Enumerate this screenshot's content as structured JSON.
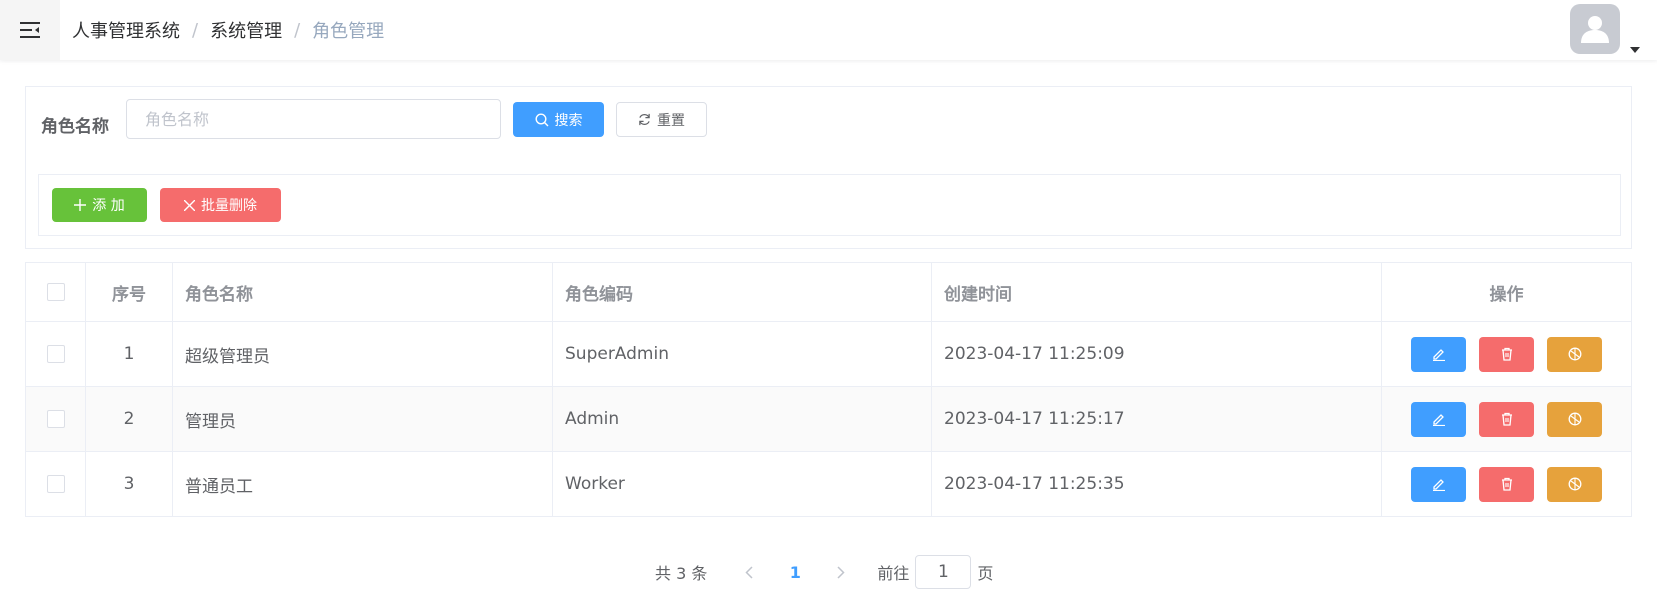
{
  "header": {
    "menu_toggle_icon": "fold-menu-icon",
    "breadcrumb": [
      "人事管理系统",
      "系统管理",
      "角色管理"
    ],
    "avatar_icon": "user-avatar-icon",
    "dropdown_icon": "caret-down-icon"
  },
  "search": {
    "label": "角色名称",
    "placeholder": "角色名称",
    "value": "",
    "search_label": "搜索",
    "reset_label": "重置"
  },
  "toolbar": {
    "add_label": "添 加",
    "batch_delete_label": "批量删除"
  },
  "table": {
    "columns": [
      "",
      "序号",
      "角色名称",
      "角色编码",
      "创建时间",
      "操作"
    ],
    "rows": [
      {
        "index": "1",
        "name": "超级管理员",
        "code": "SuperAdmin",
        "created": "2023-04-17 11:25:09"
      },
      {
        "index": "2",
        "name": "管理员",
        "code": "Admin",
        "created": "2023-04-17 11:25:17"
      },
      {
        "index": "3",
        "name": "普通员工",
        "code": "Worker",
        "created": "2023-04-17 11:25:35"
      }
    ],
    "row_actions": [
      "edit-icon",
      "delete-icon",
      "permission-icon"
    ]
  },
  "pagination": {
    "total_text": "共 3 条",
    "current_page": "1",
    "goto_prefix": "前往",
    "goto_value": "1",
    "goto_suffix": "页"
  },
  "colors": {
    "primary": "#409eff",
    "success": "#67c23a",
    "danger": "#f56c6c",
    "warning": "#e6a23c"
  }
}
